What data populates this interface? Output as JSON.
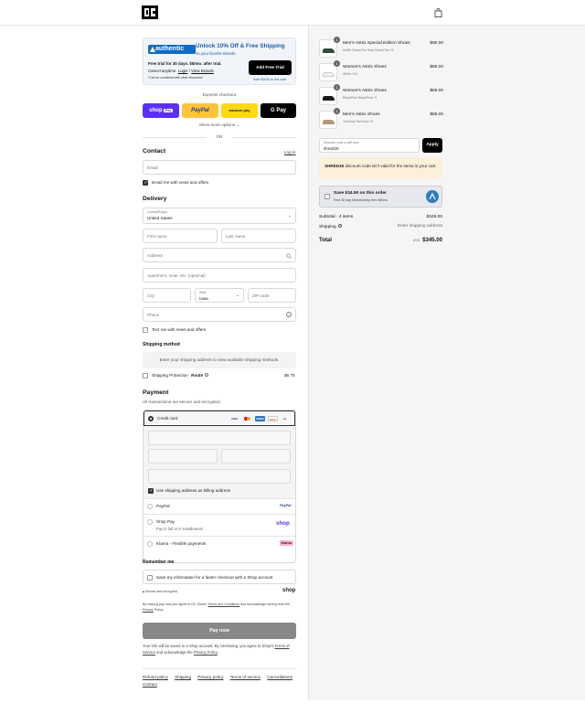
{
  "header": {
    "logo_icon": "dc-logo",
    "cart_icon": "shopping-bag-icon"
  },
  "promo": {
    "brand": "authentic",
    "title": "Unlock 10% Off & Free Shipping",
    "subtitle": "on your favorite Brands",
    "line1": "Free trial for 30 days. $5/mo. after trial.",
    "line2_prefix": "Cancel anytime.",
    "login": "Login",
    "sep": "/",
    "view_brands": "View Brands",
    "line3": "*Can be combined with other discounts*",
    "button": "Add Free Trial",
    "note": "Save $34.50 on this order"
  },
  "express": {
    "title": "Express checkout",
    "shop_label": "shop",
    "shop_badge": "Pay",
    "paypal_label": "PayPal",
    "amazon_label": "amazon pay",
    "gpay_label": "G Pay",
    "more": "Show more options ⌄",
    "or": "OR"
  },
  "contact": {
    "heading": "Contact",
    "login": "Log in",
    "email_placeholder": "Email",
    "news_label": "Email me with news and offers",
    "news_checked": true
  },
  "delivery": {
    "heading": "Delivery",
    "country_label": "Country/Region",
    "country_value": "United States",
    "first_name": "First name",
    "last_name": "Last name",
    "address": "Address",
    "apartment": "Apartment, suite, etc. (optional)",
    "city": "City",
    "state_label": "State",
    "state_value": "Iowa",
    "zip": "ZIP code",
    "phone": "Phone",
    "text_label": "Text me with news and offers"
  },
  "shipping_method": {
    "heading": "Shipping method",
    "message": "Enter your shipping address to view available shipping methods.",
    "protection_label": "Shipping Protection",
    "route": "Route",
    "protection_price": "$6.75"
  },
  "payment": {
    "heading": "Payment",
    "subtitle": "All transactions are secure and encrypted.",
    "credit_card": "Credit card",
    "cards": [
      "VISA",
      "MC",
      "AMEX",
      "DISC"
    ],
    "more_cards": "+3",
    "billing_label": "Use shipping address as billing address",
    "paypal": "PayPal",
    "paypal_logo": "PayPal",
    "shoppay": "Shop Pay",
    "shoppay_sub": "Pay in full or in installments",
    "shoppay_logo": "shop",
    "klarna": "Klarna - Flexible payments",
    "klarna_logo": "Klarna."
  },
  "remember": {
    "heading": "Remember me",
    "save_label": "Save my information for a faster checkout with a Shop account",
    "secure": "Secure and encrypted",
    "shop_logo": "shop"
  },
  "legal": {
    "prefix": "By clicking pay now you agree to DC Shoes'",
    "terms": "Terms and Conditions",
    "middle": "and acknowledge having read the",
    "privacy": "Privacy",
    "end": "Policy"
  },
  "paynow": "Pay now",
  "shop_note": {
    "text1": "Your info will be saved to a Shop account. By continuing, you agree to Shop's",
    "terms": "Terms of Service",
    "text2": "and acknowledge the",
    "privacy": "Privacy Policy",
    "end": "."
  },
  "footer": [
    "Refund policy",
    "Shipping",
    "Privacy policy",
    "Terms of service",
    "Cancellations",
    "Contact"
  ],
  "cart": {
    "items": [
      {
        "qty": "1",
        "name": "Men's Astrix Special Edition Shoes",
        "variant": "Dk/Bk Green/Tan Dark Green/Tan / 6",
        "price": "$90.00",
        "color": "#2f4b3c"
      },
      {
        "qty": "1",
        "name": "Women's Astrix Shoes",
        "variant": "White / 6.5",
        "price": "$85.00",
        "color": "#f2f2f2"
      },
      {
        "qty": "1",
        "name": "Women's Astrix Shoes",
        "variant": "Black/Pink Black/Pink / 5",
        "price": "$85.00",
        "color": "#1a1a1a"
      },
      {
        "qty": "1",
        "name": "Men's Astrix Shoes",
        "variant": "Tan/Grey Tan/Grey / 6",
        "price": "$85.00",
        "color": "#b09a7a"
      }
    ],
    "discount_label": "Discount code or gift card",
    "discount_value": "shred25",
    "apply": "Apply",
    "error_code": "SHRED25",
    "error_text": "discount code isn't valid for the items in your cart",
    "save_title": "Save $34.50 on this order",
    "save_sub": "Free 30 day Membership then $5/mo.",
    "subtotal_label": "Subtotal · 4 items",
    "subtotal_value": "$345.00",
    "shipping_label": "Shipping",
    "shipping_value": "Enter shipping address",
    "total_label": "Total",
    "currency": "USD",
    "total_value": "$345.00"
  },
  "colors": {
    "shop": "#5a31f4",
    "paypal": "#ffc439",
    "amazon": "#ffd814",
    "primary": "#000000",
    "error_bg": "#fcefdc"
  }
}
